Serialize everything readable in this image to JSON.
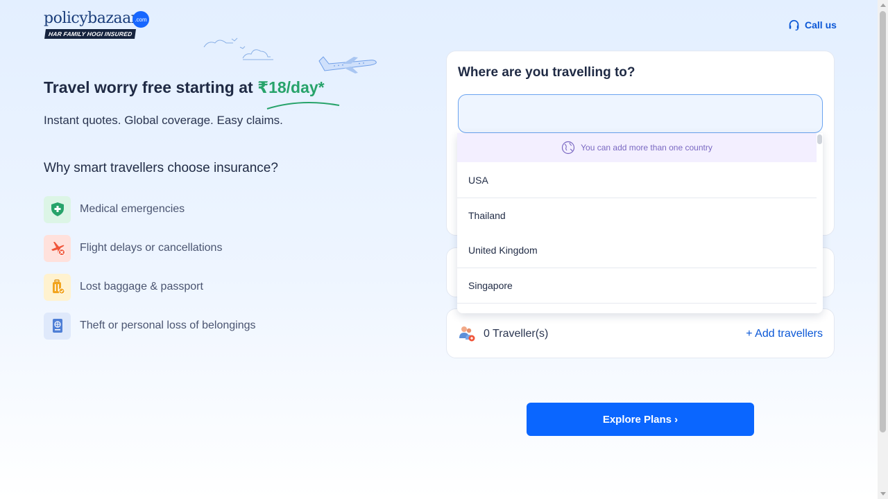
{
  "brand": {
    "name_part1": "policy",
    "name_part2": "bazaar",
    "badge": ".com",
    "tagline": "HAR FAMILY HOGI INSURED",
    "color": "#1767ff"
  },
  "header": {
    "call_us_label": "Call us",
    "call_icon": "headset-icon"
  },
  "hero": {
    "title_prefix": "Travel worry free starting at ",
    "price": "₹18/day*",
    "subtitle": "Instant quotes. Global coverage. Easy claims.",
    "why_title": "Why smart travellers choose insurance?"
  },
  "benefits": [
    {
      "label": "Medical emergencies",
      "icon": "medical-shield-icon",
      "color": "#27a36a"
    },
    {
      "label": "Flight delays or cancellations",
      "icon": "flight-cancel-icon",
      "color": "#f0553a"
    },
    {
      "label": "Lost baggage & passport",
      "icon": "baggage-icon",
      "color": "#f2a51e"
    },
    {
      "label": "Theft or personal loss of belongings",
      "icon": "passport-icon",
      "color": "#4f7fd6"
    }
  ],
  "form": {
    "destination_title": "Where are you travelling to?",
    "destination_value": "",
    "dropdown_hint": "You can add more than one country",
    "countries": [
      "USA",
      "Thailand",
      "United Kingdom",
      "Singapore",
      ""
    ],
    "travellers_count": "0 Traveller(s)",
    "add_travellers": "+ Add travellers",
    "explore_label": "Explore Plans ›"
  },
  "colors": {
    "accent": "#0a66ff",
    "price_green": "#27a36a",
    "hint_purple": "#7a68c2"
  }
}
